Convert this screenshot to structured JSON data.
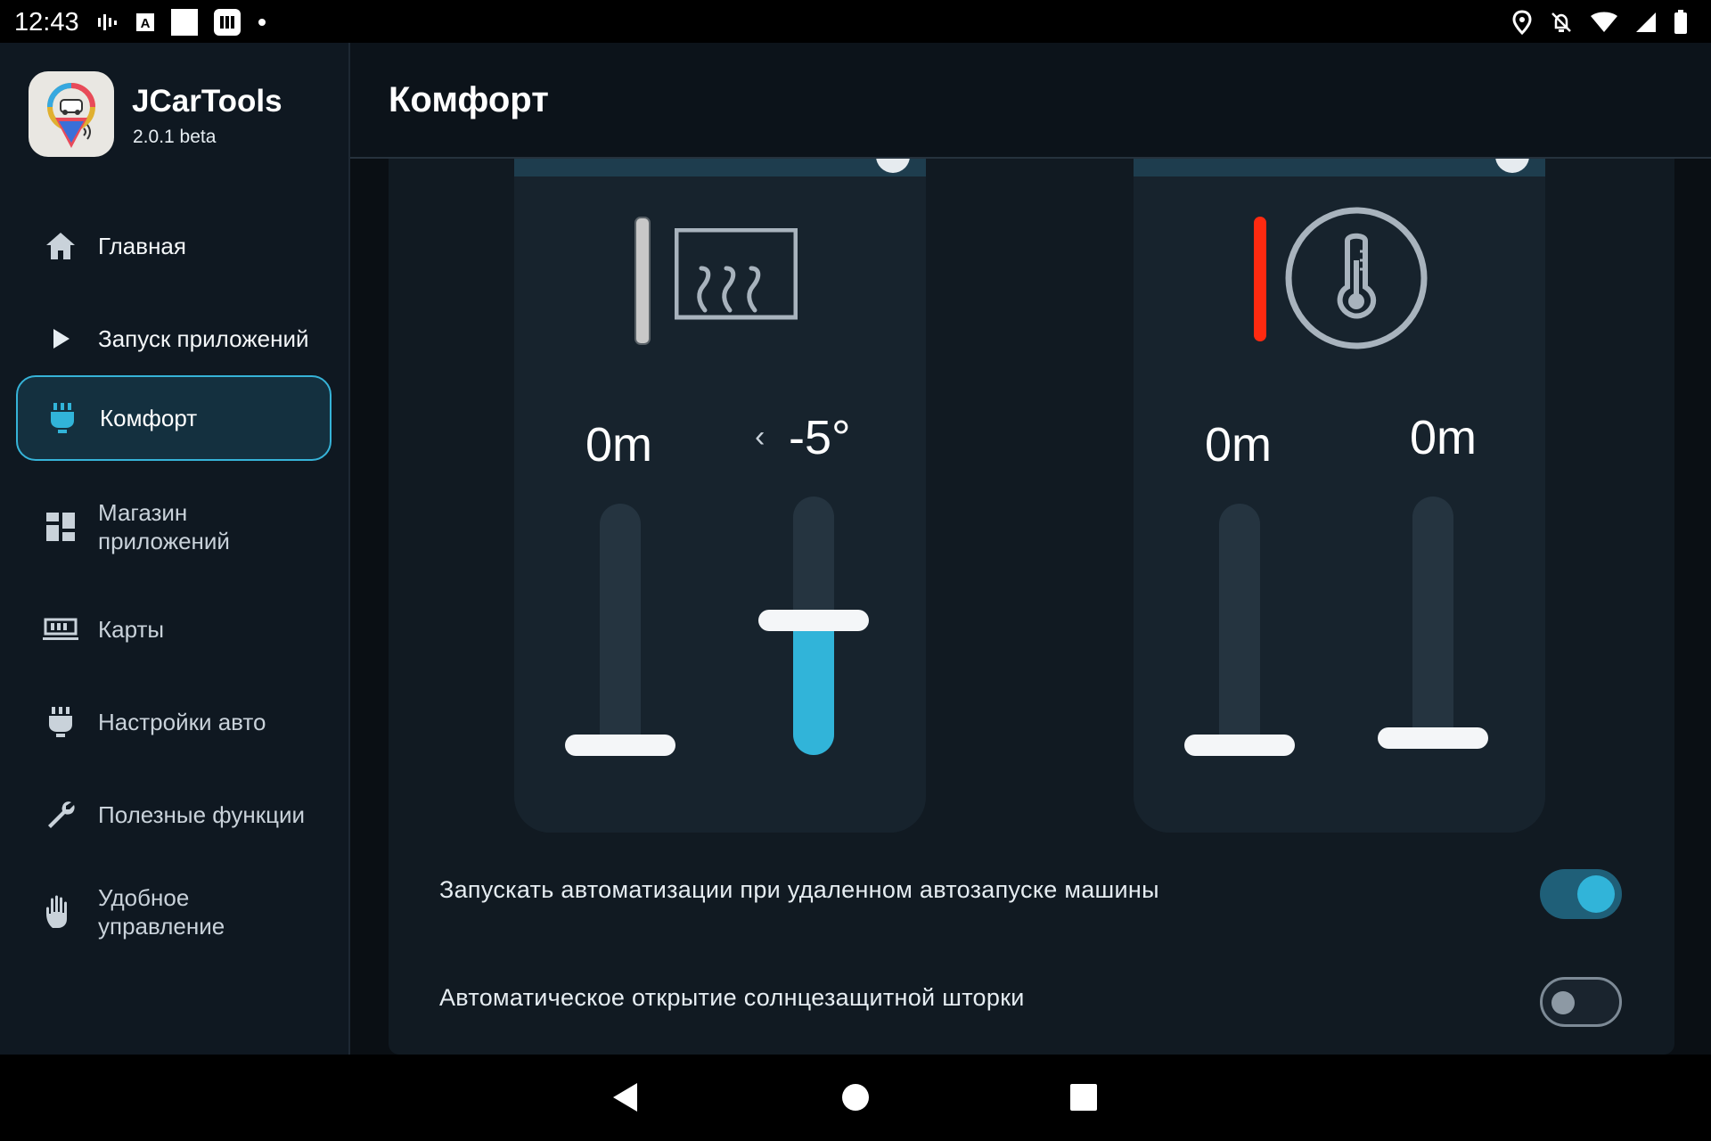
{
  "status_bar": {
    "time": "12:43",
    "left_icons": [
      "signal-bars-icon",
      "font-a-icon",
      "white-square-icon",
      "media-app-icon",
      "notification-dot-icon"
    ],
    "right_icons": [
      "location-icon",
      "bell-off-icon",
      "wifi-icon",
      "cell-signal-icon",
      "battery-icon"
    ]
  },
  "app": {
    "name": "JCarTools",
    "version": "2.0.1 beta",
    "logo_icon": "app-logo-icon"
  },
  "sidebar": {
    "items": [
      {
        "label": "Главная",
        "icon": "home-icon",
        "active": false
      },
      {
        "label": "Запуск приложений",
        "icon": "play-icon",
        "active": false
      },
      {
        "label": "Комфорт",
        "icon": "seat-icon",
        "active": true
      },
      {
        "label": "Магазин приложений",
        "icon": "grid-icon",
        "active": false
      },
      {
        "label": "Карты",
        "icon": "map-icon",
        "active": false
      },
      {
        "label": "Настройки авто",
        "icon": "car-settings-icon",
        "active": false
      },
      {
        "label": "Полезные функции",
        "icon": "wrench-icon",
        "active": false
      },
      {
        "label": "Удобное управление",
        "icon": "hand-icon",
        "active": false
      }
    ]
  },
  "header": {
    "title": "Комфорт"
  },
  "cards": [
    {
      "icon": "rear-defrost-icon",
      "indicator_color": "#c8c8c8",
      "left_value": "0m",
      "right_value": "-5°",
      "right_has_chevron": true,
      "left_slider_level": 0,
      "right_slider_level": 0.5
    },
    {
      "icon": "thermometer-icon",
      "indicator_color": "#ff2a10",
      "left_value": "0m",
      "right_value": "0m",
      "right_has_chevron": false,
      "left_slider_level": 0,
      "right_slider_level": 0
    }
  ],
  "settings": [
    {
      "label": "Запускать автоматизации при удаленном автозапуске машины",
      "enabled": true
    },
    {
      "label": "Автоматическое открытие солнцезащитной шторки",
      "enabled": false
    }
  ],
  "colors": {
    "accent": "#31b4d9",
    "sidebar_bg": "#0f1821",
    "card_bg": "#17232d",
    "active_border": "#36b3d8"
  },
  "nav_bar": {
    "buttons": [
      "back-icon",
      "home-circle-icon",
      "recents-icon"
    ]
  }
}
